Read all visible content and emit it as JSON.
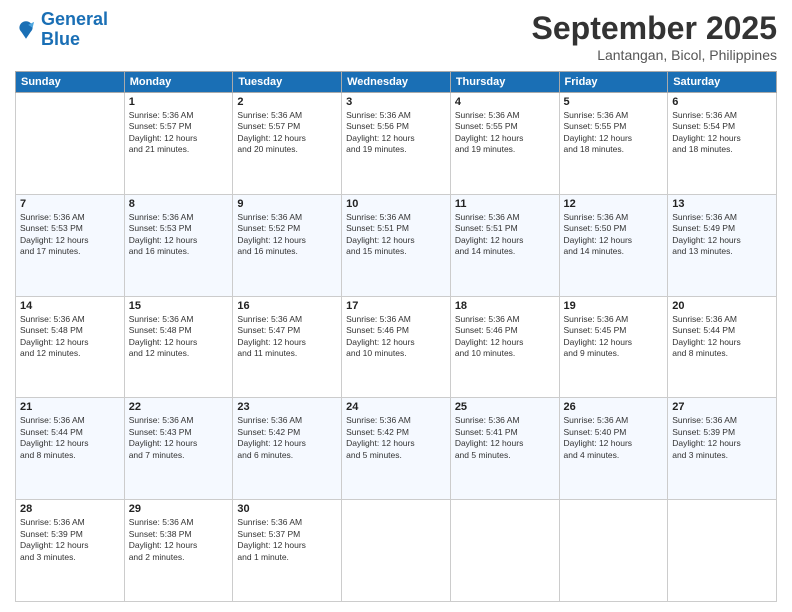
{
  "logo": {
    "line1": "General",
    "line2": "Blue"
  },
  "title": "September 2025",
  "location": "Lantangan, Bicol, Philippines",
  "weekdays": [
    "Sunday",
    "Monday",
    "Tuesday",
    "Wednesday",
    "Thursday",
    "Friday",
    "Saturday"
  ],
  "weeks": [
    [
      {
        "day": "",
        "info": ""
      },
      {
        "day": "1",
        "info": "Sunrise: 5:36 AM\nSunset: 5:57 PM\nDaylight: 12 hours\nand 21 minutes."
      },
      {
        "day": "2",
        "info": "Sunrise: 5:36 AM\nSunset: 5:57 PM\nDaylight: 12 hours\nand 20 minutes."
      },
      {
        "day": "3",
        "info": "Sunrise: 5:36 AM\nSunset: 5:56 PM\nDaylight: 12 hours\nand 19 minutes."
      },
      {
        "day": "4",
        "info": "Sunrise: 5:36 AM\nSunset: 5:55 PM\nDaylight: 12 hours\nand 19 minutes."
      },
      {
        "day": "5",
        "info": "Sunrise: 5:36 AM\nSunset: 5:55 PM\nDaylight: 12 hours\nand 18 minutes."
      },
      {
        "day": "6",
        "info": "Sunrise: 5:36 AM\nSunset: 5:54 PM\nDaylight: 12 hours\nand 18 minutes."
      }
    ],
    [
      {
        "day": "7",
        "info": "Sunrise: 5:36 AM\nSunset: 5:53 PM\nDaylight: 12 hours\nand 17 minutes."
      },
      {
        "day": "8",
        "info": "Sunrise: 5:36 AM\nSunset: 5:53 PM\nDaylight: 12 hours\nand 16 minutes."
      },
      {
        "day": "9",
        "info": "Sunrise: 5:36 AM\nSunset: 5:52 PM\nDaylight: 12 hours\nand 16 minutes."
      },
      {
        "day": "10",
        "info": "Sunrise: 5:36 AM\nSunset: 5:51 PM\nDaylight: 12 hours\nand 15 minutes."
      },
      {
        "day": "11",
        "info": "Sunrise: 5:36 AM\nSunset: 5:51 PM\nDaylight: 12 hours\nand 14 minutes."
      },
      {
        "day": "12",
        "info": "Sunrise: 5:36 AM\nSunset: 5:50 PM\nDaylight: 12 hours\nand 14 minutes."
      },
      {
        "day": "13",
        "info": "Sunrise: 5:36 AM\nSunset: 5:49 PM\nDaylight: 12 hours\nand 13 minutes."
      }
    ],
    [
      {
        "day": "14",
        "info": "Sunrise: 5:36 AM\nSunset: 5:48 PM\nDaylight: 12 hours\nand 12 minutes."
      },
      {
        "day": "15",
        "info": "Sunrise: 5:36 AM\nSunset: 5:48 PM\nDaylight: 12 hours\nand 12 minutes."
      },
      {
        "day": "16",
        "info": "Sunrise: 5:36 AM\nSunset: 5:47 PM\nDaylight: 12 hours\nand 11 minutes."
      },
      {
        "day": "17",
        "info": "Sunrise: 5:36 AM\nSunset: 5:46 PM\nDaylight: 12 hours\nand 10 minutes."
      },
      {
        "day": "18",
        "info": "Sunrise: 5:36 AM\nSunset: 5:46 PM\nDaylight: 12 hours\nand 10 minutes."
      },
      {
        "day": "19",
        "info": "Sunrise: 5:36 AM\nSunset: 5:45 PM\nDaylight: 12 hours\nand 9 minutes."
      },
      {
        "day": "20",
        "info": "Sunrise: 5:36 AM\nSunset: 5:44 PM\nDaylight: 12 hours\nand 8 minutes."
      }
    ],
    [
      {
        "day": "21",
        "info": "Sunrise: 5:36 AM\nSunset: 5:44 PM\nDaylight: 12 hours\nand 8 minutes."
      },
      {
        "day": "22",
        "info": "Sunrise: 5:36 AM\nSunset: 5:43 PM\nDaylight: 12 hours\nand 7 minutes."
      },
      {
        "day": "23",
        "info": "Sunrise: 5:36 AM\nSunset: 5:42 PM\nDaylight: 12 hours\nand 6 minutes."
      },
      {
        "day": "24",
        "info": "Sunrise: 5:36 AM\nSunset: 5:42 PM\nDaylight: 12 hours\nand 5 minutes."
      },
      {
        "day": "25",
        "info": "Sunrise: 5:36 AM\nSunset: 5:41 PM\nDaylight: 12 hours\nand 5 minutes."
      },
      {
        "day": "26",
        "info": "Sunrise: 5:36 AM\nSunset: 5:40 PM\nDaylight: 12 hours\nand 4 minutes."
      },
      {
        "day": "27",
        "info": "Sunrise: 5:36 AM\nSunset: 5:39 PM\nDaylight: 12 hours\nand 3 minutes."
      }
    ],
    [
      {
        "day": "28",
        "info": "Sunrise: 5:36 AM\nSunset: 5:39 PM\nDaylight: 12 hours\nand 3 minutes."
      },
      {
        "day": "29",
        "info": "Sunrise: 5:36 AM\nSunset: 5:38 PM\nDaylight: 12 hours\nand 2 minutes."
      },
      {
        "day": "30",
        "info": "Sunrise: 5:36 AM\nSunset: 5:37 PM\nDaylight: 12 hours\nand 1 minute."
      },
      {
        "day": "",
        "info": ""
      },
      {
        "day": "",
        "info": ""
      },
      {
        "day": "",
        "info": ""
      },
      {
        "day": "",
        "info": ""
      }
    ]
  ]
}
